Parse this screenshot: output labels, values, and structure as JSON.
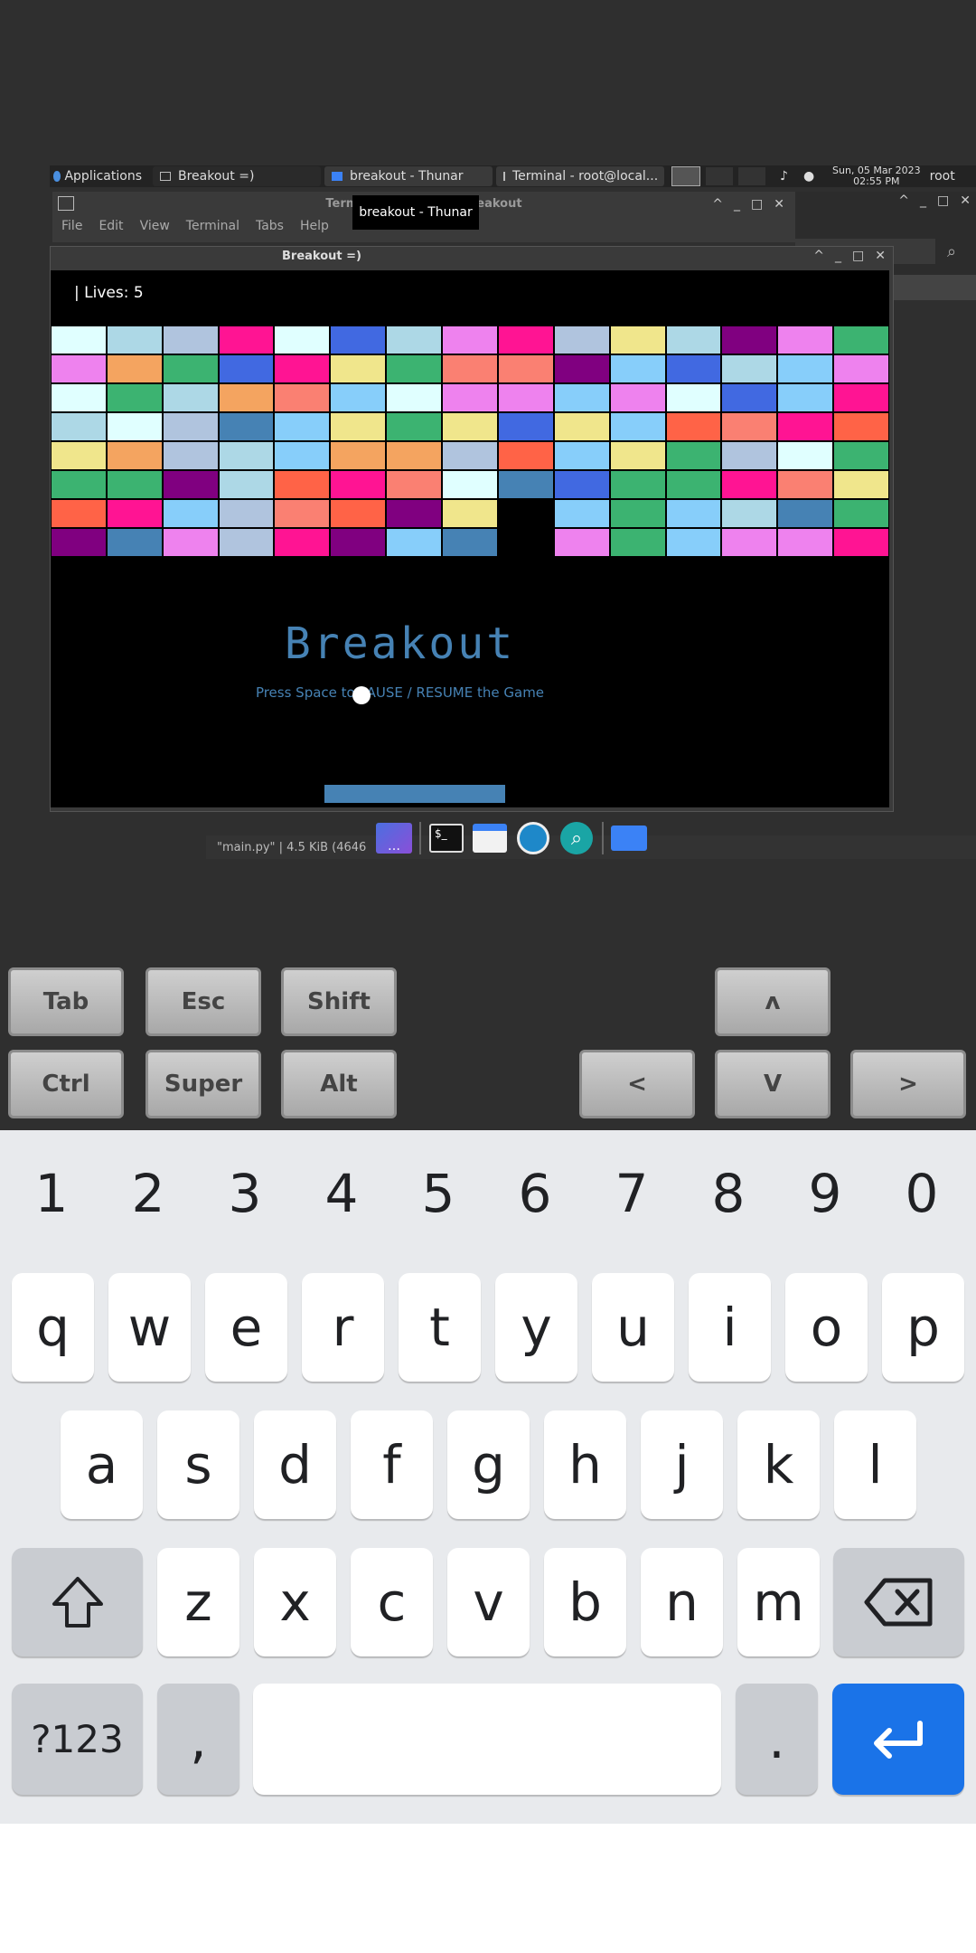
{
  "panel": {
    "applications": "Applications",
    "tasks": [
      {
        "label": "Breakout =)",
        "active": true
      },
      {
        "label": "breakout - Thunar",
        "active": false
      },
      {
        "label": "Terminal - root@local...",
        "active": false
      }
    ],
    "clock_date": "Sun, 05 Mar 2023",
    "clock_time": "02:55 PM",
    "user": "root"
  },
  "tooltip": "breakout - Thunar",
  "terminal": {
    "title": "Terminal - root@lo        s/breakout",
    "menu": [
      "File",
      "Edit",
      "View",
      "Terminal",
      "Tabs",
      "Help"
    ]
  },
  "window": {
    "title": "Breakout =)"
  },
  "game": {
    "lives_text": "| Lives: 5",
    "title": "Breakout",
    "instruction": "Press Space to PAUSE / RESUME the Game",
    "bricks": {
      "cols": 15,
      "rows": [
        [
          "#e0ffff",
          "#add8e6",
          "#b0c4de",
          "#ff1493",
          "#e0ffff",
          "#4169e1",
          "#add8e6",
          "#ee82ee",
          "#ff1493",
          "#b0c4de",
          "#f0e68c",
          "#add8e6",
          "#800080",
          "#ee82ee",
          "#3cb371"
        ],
        [
          "#ee82ee",
          "#f4a460",
          "#3cb371",
          "#4169e1",
          "#ff1493",
          "#f0e68c",
          "#3cb371",
          "#fa8072",
          "#fa8072",
          "#800080",
          "#87cefa",
          "#4169e1",
          "#add8e6",
          "#87cefa",
          "#ee82ee"
        ],
        [
          "#e0ffff",
          "#3cb371",
          "#add8e6",
          "#f4a460",
          "#fa8072",
          "#87cefa",
          "#e0ffff",
          "#ee82ee",
          "#ee82ee",
          "#87cefa",
          "#ee82ee",
          "#e0ffff",
          "#4169e1",
          "#87cefa",
          "#ff1493"
        ],
        [
          "#add8e6",
          "#e0ffff",
          "#b0c4de",
          "#4682b4",
          "#87cefa",
          "#f0e68c",
          "#3cb371",
          "#f0e68c",
          "#4169e1",
          "#f0e68c",
          "#87cefa",
          "#ff6347",
          "#fa8072",
          "#ff1493",
          "#ff6347"
        ],
        [
          "#f0e68c",
          "#f4a460",
          "#b0c4de",
          "#add8e6",
          "#87cefa",
          "#f4a460",
          "#f4a460",
          "#b0c4de",
          "#ff6347",
          "#87cefa",
          "#f0e68c",
          "#3cb371",
          "#b0c4de",
          "#e0ffff",
          "#3cb371"
        ],
        [
          "#3cb371",
          "#3cb371",
          "#800080",
          "#add8e6",
          "#ff6347",
          "#ff1493",
          "#fa8072",
          "#e0ffff",
          "#4682b4",
          "#4169e1",
          "#3cb371",
          "#3cb371",
          "#ff1493",
          "#fa8072",
          "#f0e68c"
        ],
        [
          "#ff6347",
          "#ff1493",
          "#87cefa",
          "#b0c4de",
          "#fa8072",
          "#ff6347",
          "#800080",
          "#f0e68c",
          null,
          "#87cefa",
          "#3cb371",
          "#87cefa",
          "#add8e6",
          "#4682b4",
          "#3cb371"
        ],
        [
          "#800080",
          "#4682b4",
          "#ee82ee",
          "#b0c4de",
          "#ff1493",
          "#800080",
          "#87cefa",
          "#4682b4",
          null,
          "#ee82ee",
          "#3cb371",
          "#87cefa",
          "#ee82ee",
          "#ee82ee",
          "#ff1493"
        ]
      ]
    },
    "colors": {
      "text": "#4682b4",
      "paddle": "#4682b4",
      "ball": "#ffffff"
    }
  },
  "editor_status": "\"main.py\"  |  4.5 KiB (4646",
  "dock": [
    "workspace-icon",
    "terminal-icon",
    "file-manager-icon",
    "web-browser-icon",
    "search-icon",
    "folder-icon"
  ],
  "special_keys": {
    "tab": "Tab",
    "esc": "Esc",
    "shift": "Shift",
    "ctrl": "Ctrl",
    "super": "Super",
    "alt": "Alt",
    "up": "ʌ",
    "down": "V",
    "left": "<",
    "right": ">"
  },
  "keyboard": {
    "numbers": [
      "1",
      "2",
      "3",
      "4",
      "5",
      "6",
      "7",
      "8",
      "9",
      "0"
    ],
    "row1": [
      "q",
      "w",
      "e",
      "r",
      "t",
      "y",
      "u",
      "i",
      "o",
      "p"
    ],
    "row2": [
      "a",
      "s",
      "d",
      "f",
      "g",
      "h",
      "j",
      "k",
      "l"
    ],
    "row3": [
      "z",
      "x",
      "c",
      "v",
      "b",
      "n",
      "m"
    ],
    "symbols": "?123",
    "comma": ",",
    "period": ".",
    "colors": {
      "enter": "#1a73e8",
      "background": "#e8eaed"
    }
  }
}
